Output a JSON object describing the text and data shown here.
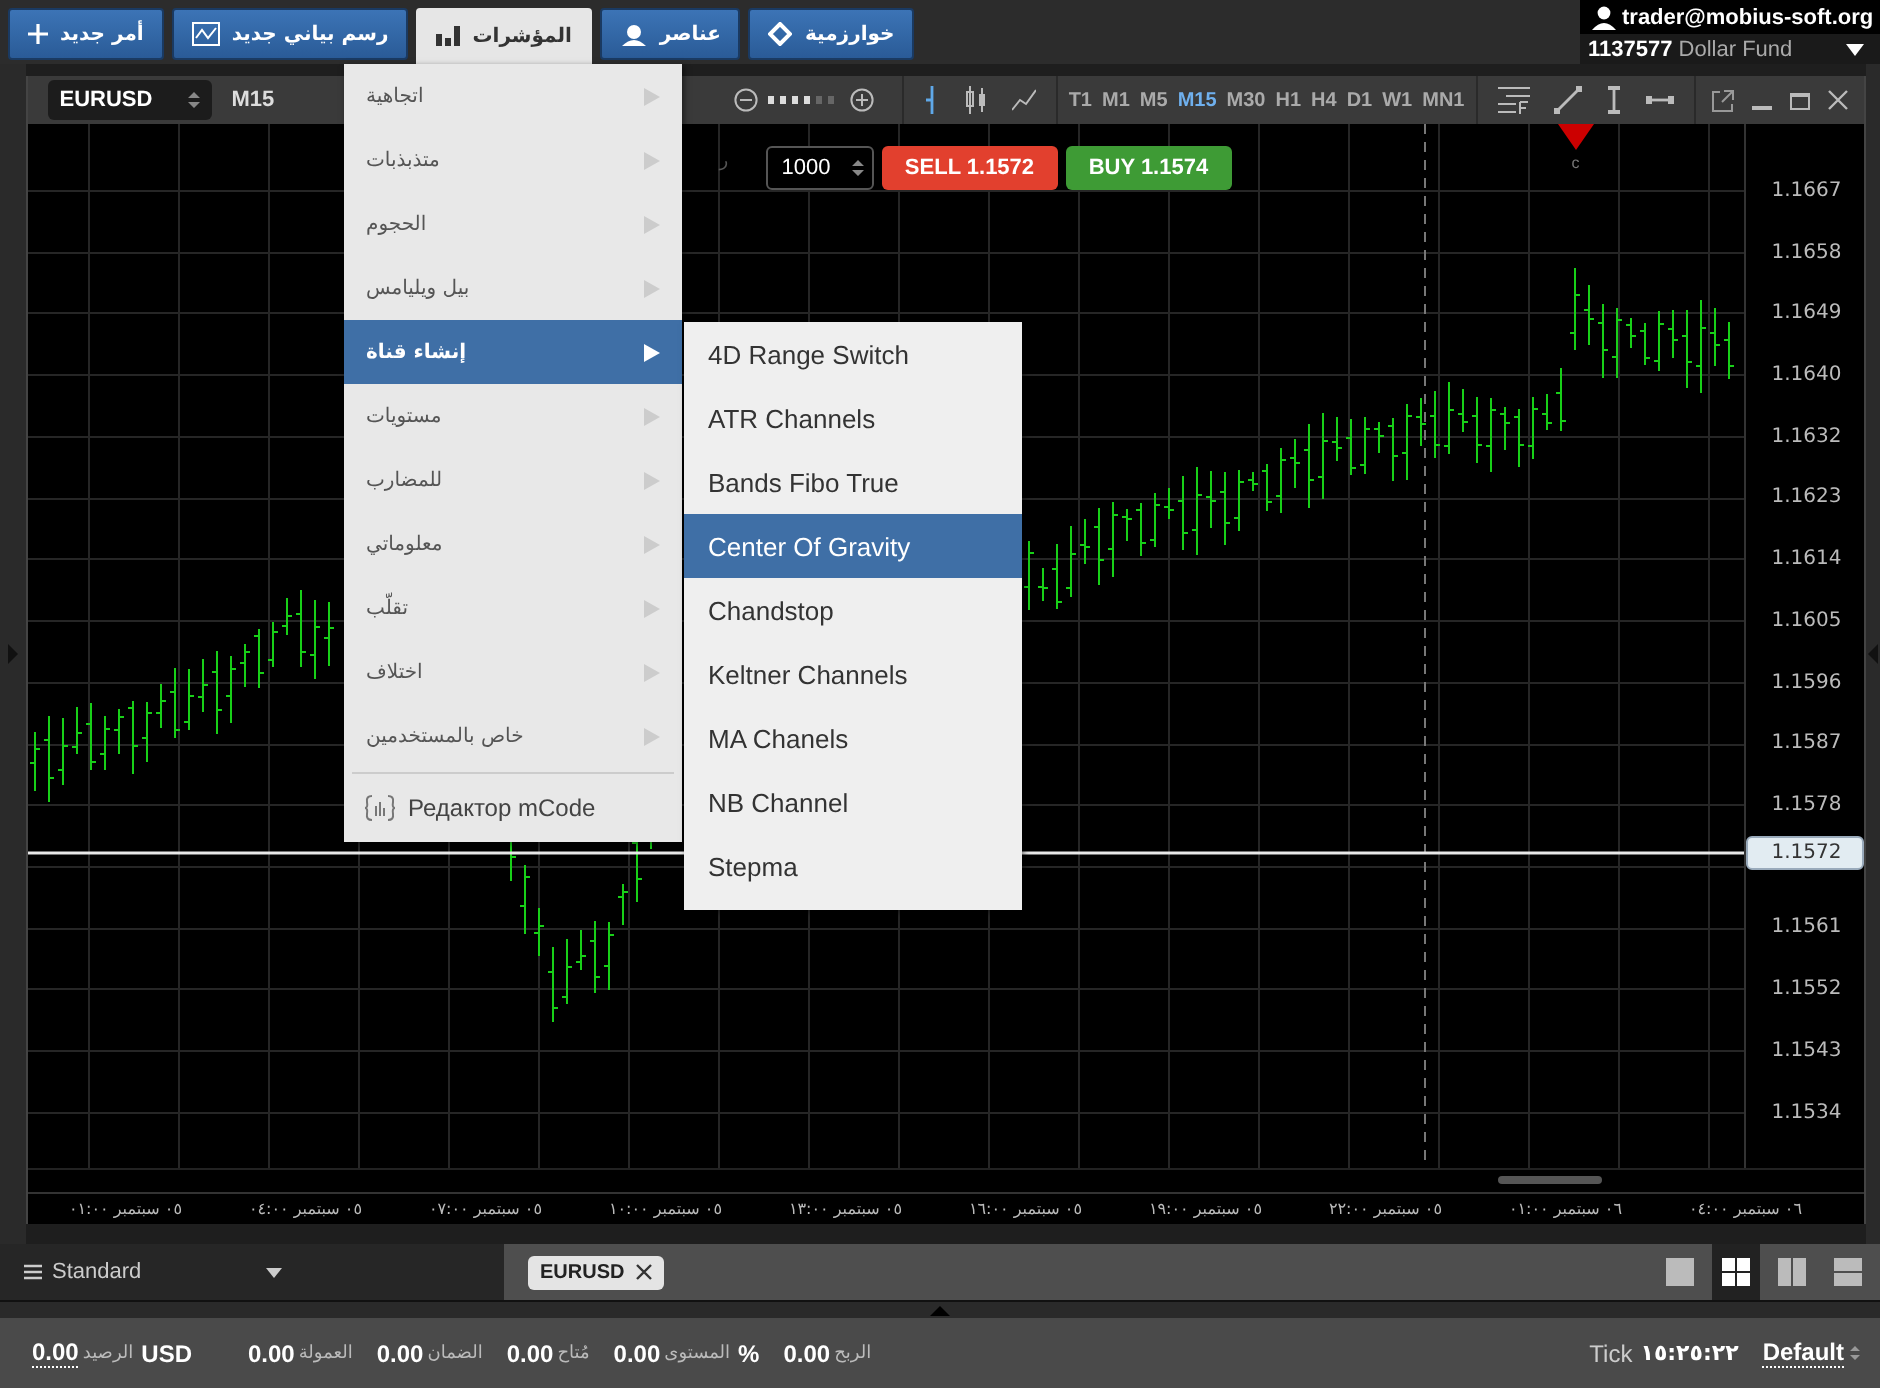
{
  "toolbar_buttons": [
    {
      "label": "خوارزمية",
      "selected": false
    },
    {
      "label": "عناصر",
      "selected": false
    },
    {
      "label": "المؤشرات",
      "selected": true
    },
    {
      "label": "رسم بياني جديد",
      "selected": false
    },
    {
      "label": "أمر جديد",
      "selected": false
    }
  ],
  "account": {
    "email": "trader@mobius-soft.org",
    "number": "1137577",
    "name": "Dollar Fund"
  },
  "indicators_menu": {
    "items": [
      {
        "label": "اتجاهية",
        "selected": false
      },
      {
        "label": "متذبذبات",
        "selected": false
      },
      {
        "label": "الحجوم",
        "selected": false
      },
      {
        "label": "بيل ويليامس",
        "selected": false
      },
      {
        "label": "إنشاء قناة",
        "selected": true
      },
      {
        "label": "مستويات",
        "selected": false
      },
      {
        "label": "للمضارب",
        "selected": false
      },
      {
        "label": "معلوماتي",
        "selected": false
      },
      {
        "label": "تقلّب",
        "selected": false
      },
      {
        "label": "اختلاف",
        "selected": false
      },
      {
        "label": "خاص بالمستخدمين",
        "selected": false
      }
    ],
    "editor": {
      "label": "Редактор mCode"
    }
  },
  "submenu": {
    "items": [
      {
        "label": "4D Range Switch",
        "selected": false
      },
      {
        "label": "ATR Channels",
        "selected": false
      },
      {
        "label": "Bands Fibo True",
        "selected": false
      },
      {
        "label": "Center Of Gravity",
        "selected": true
      },
      {
        "label": "Chandstop",
        "selected": false
      },
      {
        "label": "Keltner Channels",
        "selected": false
      },
      {
        "label": "MA Chanels",
        "selected": false
      },
      {
        "label": "NB Channel",
        "selected": false
      },
      {
        "label": "Stepma",
        "selected": false
      }
    ]
  },
  "chart_window": {
    "symbol": "EURUSD",
    "timeframe": "M15",
    "zoom": {
      "level": 0.67
    },
    "timeframes": [
      {
        "label": "MN1",
        "selected": false
      },
      {
        "label": "W1",
        "selected": false
      },
      {
        "label": "D1",
        "selected": false
      },
      {
        "label": "H4",
        "selected": false
      },
      {
        "label": "H1",
        "selected": false
      },
      {
        "label": "M30",
        "selected": false
      },
      {
        "label": "M15",
        "selected": true
      },
      {
        "label": "M5",
        "selected": false
      },
      {
        "label": "M1",
        "selected": false
      },
      {
        "label": "T1",
        "selected": false
      }
    ],
    "order": {
      "quantity": "1000",
      "sell": {
        "label": "SELL",
        "price": "1.1572"
      },
      "buy": {
        "label": "BUY",
        "price": "1.1574"
      }
    },
    "marker_text": "ر",
    "event_label": "c",
    "price_axis": [
      {
        "kind": "tick",
        "text": "1.1667"
      },
      {
        "kind": "tick",
        "text": "1.1658"
      },
      {
        "kind": "tick",
        "text": "1.1649"
      },
      {
        "kind": "tick",
        "text": "1.1640"
      },
      {
        "kind": "tick",
        "text": "1.1632"
      },
      {
        "kind": "tick",
        "text": "1.1623"
      },
      {
        "kind": "tick",
        "text": "1.1614"
      },
      {
        "kind": "tick",
        "text": "1.1605"
      },
      {
        "kind": "tick",
        "text": "1.1596"
      },
      {
        "kind": "tick",
        "text": "1.1587"
      },
      {
        "kind": "tick",
        "text": "1.1578"
      },
      {
        "kind": "current",
        "text": "1.1572"
      },
      {
        "kind": "tick",
        "text": "1.1561"
      },
      {
        "kind": "tick",
        "text": "1.1552"
      },
      {
        "kind": "tick",
        "text": "1.1543"
      },
      {
        "kind": "tick",
        "text": "1.1534"
      }
    ],
    "time_axis": [
      "٠٦ سبتمبر ٠٤:٠٠",
      "٠٦ سبتمبر ٠١:٠٠",
      "٠٥ سبتمبر ٢٢:٠٠",
      "٠٥ سبتمبر ١٩:٠٠",
      "٠٥ سبتمبر ١٦:٠٠",
      "٠٥ سبتمبر ١٣:٠٠",
      "٠٥ سبتمبر ١٠:٠٠",
      "٠٥ سبتمبر ٠٧:٠٠",
      "٠٥ سبتمبر ٠٤:٠٠",
      "٠٥ سبتمبر ٠١:٠٠"
    ]
  },
  "bottom_tabs": {
    "layout_name": "Standard",
    "tabs": [
      {
        "label": "EURUSD",
        "selected": true
      }
    ],
    "layouts": [
      {
        "kind": "single",
        "selected": false
      },
      {
        "kind": "grid",
        "selected": true
      },
      {
        "kind": "columns",
        "selected": false
      },
      {
        "kind": "rows",
        "selected": false
      }
    ]
  },
  "status_bar": {
    "items": [
      {
        "kind": "metric",
        "value": "0.00",
        "label": "الربح"
      },
      {
        "kind": "metric",
        "value": "0.00",
        "label": "المستوى",
        "unit": "%"
      },
      {
        "kind": "metric",
        "value": "0.00",
        "label": "مُتاح"
      },
      {
        "kind": "metric",
        "value": "0.00",
        "label": "الضمان"
      },
      {
        "kind": "metric",
        "value": "0.00",
        "label": "العمولة"
      },
      {
        "kind": "balance",
        "value": "0.00",
        "label": "الرصيد",
        "unit": "USD"
      }
    ],
    "tick_label": "Tick",
    "time": "١٥:٢٥:٢٢",
    "profile": "Default"
  }
}
